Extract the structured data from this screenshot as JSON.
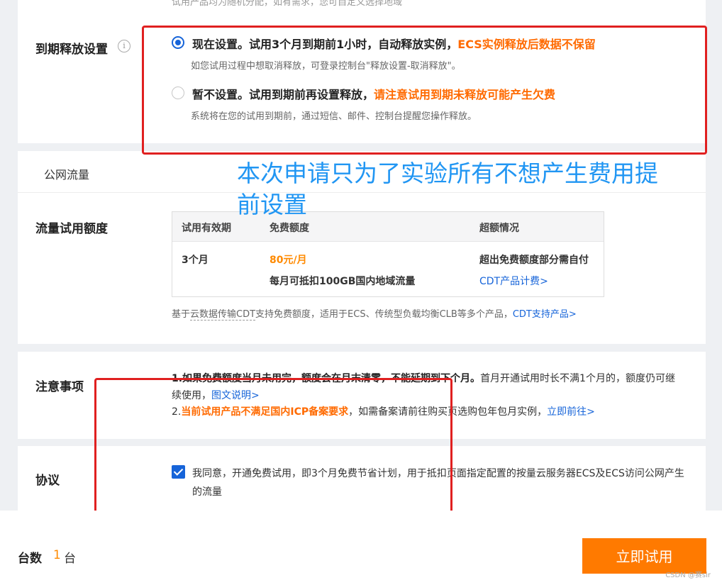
{
  "top_cut_text": "试用产品均为随机分配，如有需求，您可自定义选择地域",
  "release": {
    "label": "到期释放设置",
    "info_glyph": "i",
    "option1_title": "现在设置。试用3个月到期前1小时，自动释放实例，",
    "option1_warn": "ECS实例释放后数据不保留",
    "option1_desc": "如您试用过程中想取消释放，可登录控制台\"释放设置-取消释放\"。",
    "option2_title": "暂不设置。试用到期前再设置释放，",
    "option2_warn": "请注意试用到期未释放可能产生欠费",
    "option2_desc": "系统将在您的试用到期前，通过短信、邮件、控制台提醒您操作释放。"
  },
  "annotation": "本次申请只为了实验所有不想产生费用提前设置",
  "traffic": {
    "tab": "公网流量",
    "label": "流量试用额度",
    "headers": [
      "试用有效期",
      "免费额度",
      "超额情况"
    ],
    "period": "3个月",
    "price": "80元/月",
    "price_desc": "每月可抵扣100GB国内地域流量",
    "overage": "超出免费额度部分需自付",
    "overage_link": "CDT产品计费>",
    "foot_prefix": "基于",
    "foot_cdt": "云数据传输CDT",
    "foot_mid": "支持免费额度，适用于ECS、传统型负载均衡CLB等多个产品，",
    "foot_link": "CDT支持产品>"
  },
  "notes": {
    "label": "注意事项",
    "line1_bold": "1.如果免费额度当月未用完，额度会在月末清零，不能延期到下个月。",
    "line1_rest": "首月开通试用时长不满1个月的，额度仍可继续使用，",
    "line1_link": "图文说明>",
    "line2_prefix": "2.",
    "line2_warn": "当前试用产品不满足国内ICP备案要求",
    "line2_rest": "，如需备案请前往购买页选购包年包月实例，",
    "line2_link": "立即前往>"
  },
  "agreement": {
    "label": "协议",
    "text": "我同意，开通免费试用，即3个月免费节省计划，用于抵扣页面指定配置的按量云服务器ECS及ECS访问公网产生的流量",
    "checked": true
  },
  "bottom": {
    "qty_label": "台数",
    "qty_value": "1",
    "qty_unit": "台",
    "button": "立即试用"
  },
  "watermark": "CSDN @赛sir",
  "colors": {
    "accent_blue": "#1664d9",
    "warn_orange": "#ff6a00",
    "button_orange": "#ff7a00",
    "annotation_blue": "#2196f3",
    "highlight_red": "#e02020"
  }
}
